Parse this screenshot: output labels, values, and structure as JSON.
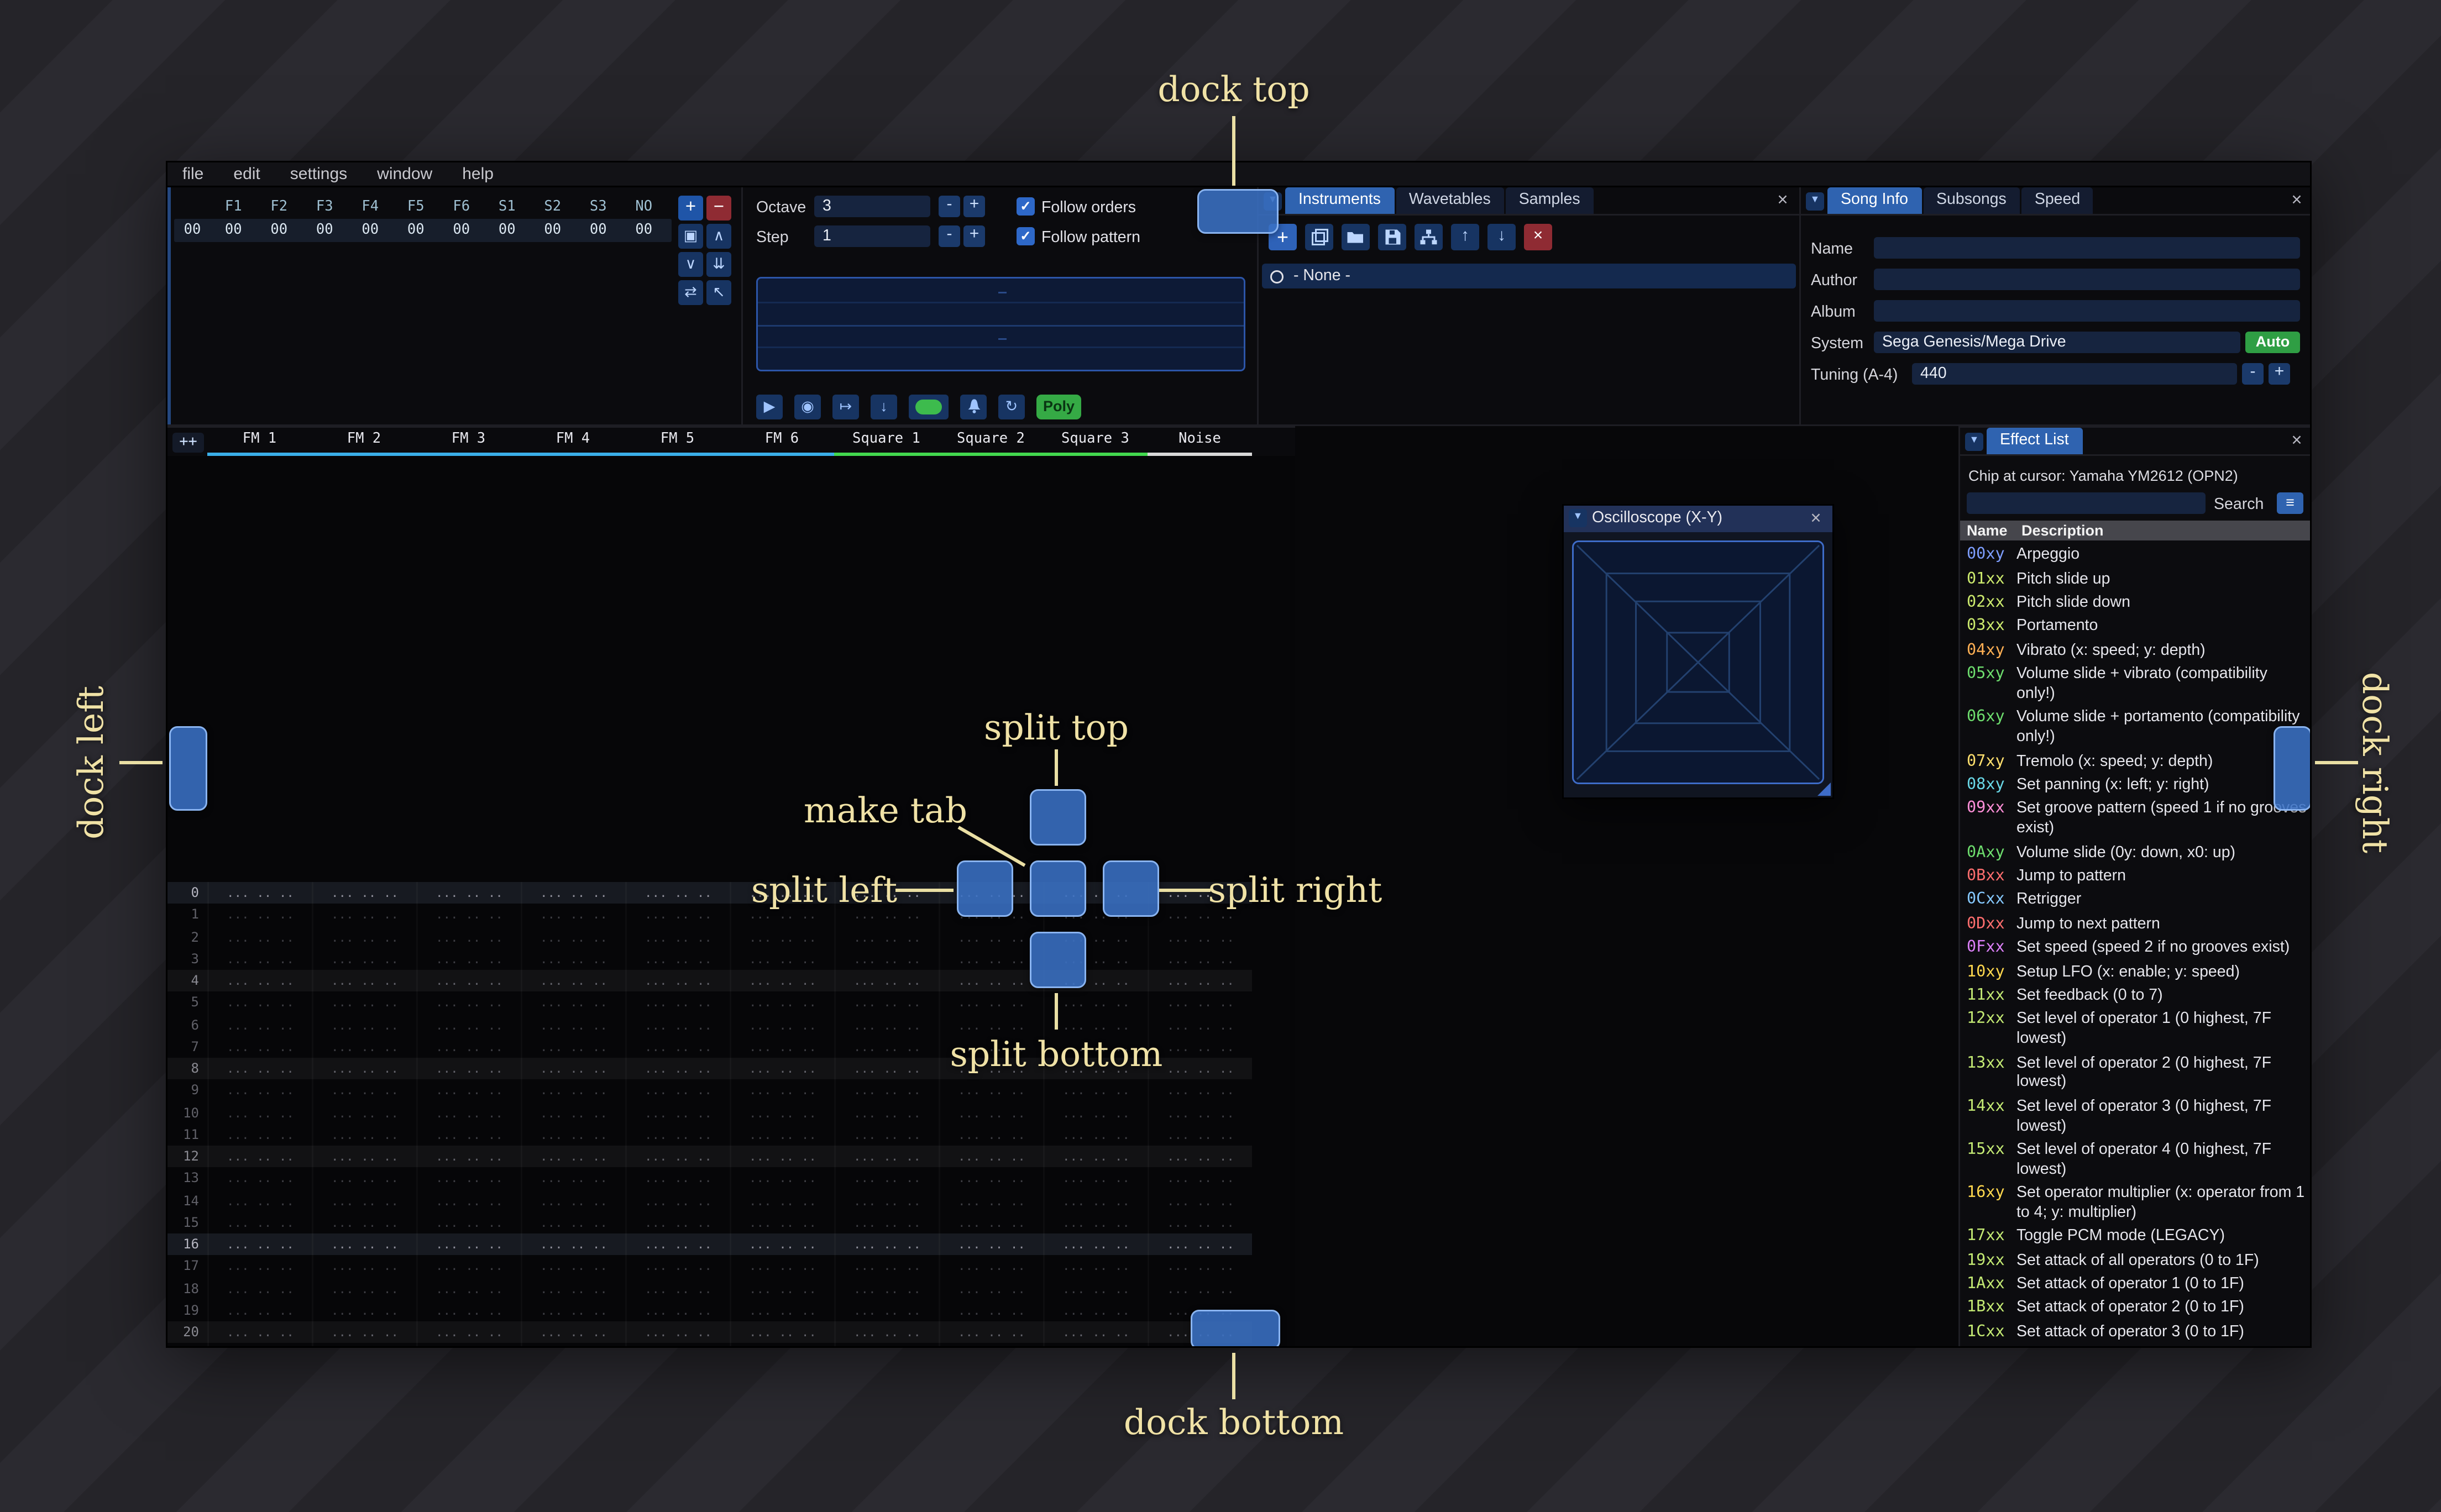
{
  "annotations": {
    "dock_top": "dock top",
    "dock_bottom": "dock bottom",
    "dock_left": "dock left",
    "dock_right": "dock right",
    "split_top": "split top",
    "split_bottom": "split bottom",
    "split_left": "split left",
    "split_right": "split right",
    "make_tab": "make tab"
  },
  "menu": {
    "items": [
      "file",
      "edit",
      "settings",
      "window",
      "help"
    ]
  },
  "orders": {
    "row_index": "00",
    "channels": [
      "F1",
      "F2",
      "F3",
      "F4",
      "F5",
      "F6",
      "S1",
      "S2",
      "S3",
      "NO"
    ],
    "values": [
      "00",
      "00",
      "00",
      "00",
      "00",
      "00",
      "00",
      "00",
      "00",
      "00"
    ],
    "buttons": [
      "add",
      "remove",
      "duplicate",
      "move-up",
      "move-down",
      "deep-clone",
      "change-all",
      "edit-mode"
    ]
  },
  "controls": {
    "octave_label": "Octave",
    "octave_value": "3",
    "step_label": "Step",
    "step_value": "1",
    "minus_label": "-",
    "plus_label": "+",
    "check_glyph": "✓",
    "follow_orders_label": "Follow orders",
    "follow_pattern_label": "Follow pattern",
    "poly_label": "Poly"
  },
  "instruments": {
    "tabs": [
      {
        "label": "Instruments",
        "active": true
      },
      {
        "label": "Wavetables",
        "active": false
      },
      {
        "label": "Samples",
        "active": false
      }
    ],
    "toolbar": [
      "add",
      "duplicate",
      "open",
      "save",
      "organize",
      "move-up",
      "move-down",
      "delete"
    ],
    "close_label": "×",
    "list": [
      "- None -"
    ]
  },
  "song_info": {
    "tabs": [
      {
        "label": "Song Info",
        "active": true
      },
      {
        "label": "Subsongs",
        "active": false
      },
      {
        "label": "Speed",
        "active": false
      }
    ],
    "close_label": "×",
    "fields": [
      {
        "label": "Name",
        "value": ""
      },
      {
        "label": "Author",
        "value": ""
      },
      {
        "label": "Album",
        "value": ""
      }
    ],
    "system": {
      "label": "System",
      "value": "Sega Genesis/Mega Drive",
      "auto_label": "Auto"
    },
    "tuning": {
      "label": "Tuning (A-4)",
      "value": "440",
      "minus_label": "-",
      "plus_label": "+"
    }
  },
  "pattern": {
    "add_channel_label": "++",
    "channels": [
      {
        "name": "FM 1",
        "color": "#3aaee8"
      },
      {
        "name": "FM 2",
        "color": "#3aaee8"
      },
      {
        "name": "FM 3",
        "color": "#3aaee8"
      },
      {
        "name": "FM 4",
        "color": "#3aaee8"
      },
      {
        "name": "FM 5",
        "color": "#3aaee8"
      },
      {
        "name": "FM 6",
        "color": "#3aaee8"
      },
      {
        "name": "Square 1",
        "color": "#42d74e"
      },
      {
        "name": "Square 2",
        "color": "#42d74e"
      },
      {
        "name": "Square 3",
        "color": "#42d74e"
      },
      {
        "name": "Noise",
        "color": "#d8d8d8"
      }
    ],
    "visible_rows": 22,
    "empty_cell": "... .. .. ....",
    "highlight1_every": 4,
    "highlight2_every": 16
  },
  "oscilloscope": {
    "title": "Oscilloscope (X-Y)",
    "close_label": "×"
  },
  "effect_list": {
    "title": "Effect List",
    "close_label": "×",
    "chip_line": "Chip at cursor: Yamaha YM2612 (OPN2)",
    "search_label": "Search",
    "search_value": "",
    "columns": [
      "Name",
      "Description"
    ],
    "effects": [
      {
        "code": "00xy",
        "color": "#7e9eff",
        "desc": "Arpeggio"
      },
      {
        "code": "01xx",
        "color": "#cdeb6e",
        "desc": "Pitch slide up"
      },
      {
        "code": "02xx",
        "color": "#cdeb6e",
        "desc": "Pitch slide down"
      },
      {
        "code": "03xx",
        "color": "#cdeb6e",
        "desc": "Portamento"
      },
      {
        "code": "04xy",
        "color": "#ffb054",
        "desc": "Vibrato (x: speed; y: depth)"
      },
      {
        "code": "05xy",
        "color": "#6ede6e",
        "desc": "Volume slide + vibrato (compatibility only!)"
      },
      {
        "code": "06xy",
        "color": "#6ede6e",
        "desc": "Volume slide + portamento (compatibility only!)"
      },
      {
        "code": "07xy",
        "color": "#ffe06e",
        "desc": "Tremolo (x: speed; y: depth)"
      },
      {
        "code": "08xy",
        "color": "#6ad9e8",
        "desc": "Set panning (x: left; y: right)"
      },
      {
        "code": "09xx",
        "color": "#ff8fd8",
        "desc": "Set groove pattern (speed 1 if no grooves exist)"
      },
      {
        "code": "0Axy",
        "color": "#6ede6e",
        "desc": "Volume slide (0y: down, x0: up)"
      },
      {
        "code": "0Bxx",
        "color": "#ff6e6e",
        "desc": "Jump to pattern"
      },
      {
        "code": "0Cxx",
        "color": "#86c9ff",
        "desc": "Retrigger"
      },
      {
        "code": "0Dxx",
        "color": "#ff6e6e",
        "desc": "Jump to next pattern"
      },
      {
        "code": "0Fxx",
        "color": "#dc80f8",
        "desc": "Set speed (speed 2 if no grooves exist)"
      },
      {
        "code": "10xy",
        "color": "#ffd84e",
        "desc": "Setup LFO (x: enable; y: speed)"
      },
      {
        "code": "11xx",
        "color": "#c4ea74",
        "desc": "Set feedback (0 to 7)"
      },
      {
        "code": "12xx",
        "color": "#c4ea74",
        "desc": "Set level of operator 1 (0 highest, 7F lowest)"
      },
      {
        "code": "13xx",
        "color": "#c4ea74",
        "desc": "Set level of operator 2 (0 highest, 7F lowest)"
      },
      {
        "code": "14xx",
        "color": "#c4ea74",
        "desc": "Set level of operator 3 (0 highest, 7F lowest)"
      },
      {
        "code": "15xx",
        "color": "#c4ea74",
        "desc": "Set level of operator 4 (0 highest, 7F lowest)"
      },
      {
        "code": "16xy",
        "color": "#ffd84e",
        "desc": "Set operator multiplier (x: operator from 1 to 4; y: multiplier)"
      },
      {
        "code": "17xx",
        "color": "#c4ea74",
        "desc": "Toggle PCM mode (LEGACY)"
      },
      {
        "code": "19xx",
        "color": "#c4ea74",
        "desc": "Set attack of all operators (0 to 1F)"
      },
      {
        "code": "1Axx",
        "color": "#c4ea74",
        "desc": "Set attack of operator 1 (0 to 1F)"
      },
      {
        "code": "1Bxx",
        "color": "#c4ea74",
        "desc": "Set attack of operator 2 (0 to 1F)"
      },
      {
        "code": "1Cxx",
        "color": "#c4ea74",
        "desc": "Set attack of operator 3 (0 to 1F)"
      }
    ]
  }
}
